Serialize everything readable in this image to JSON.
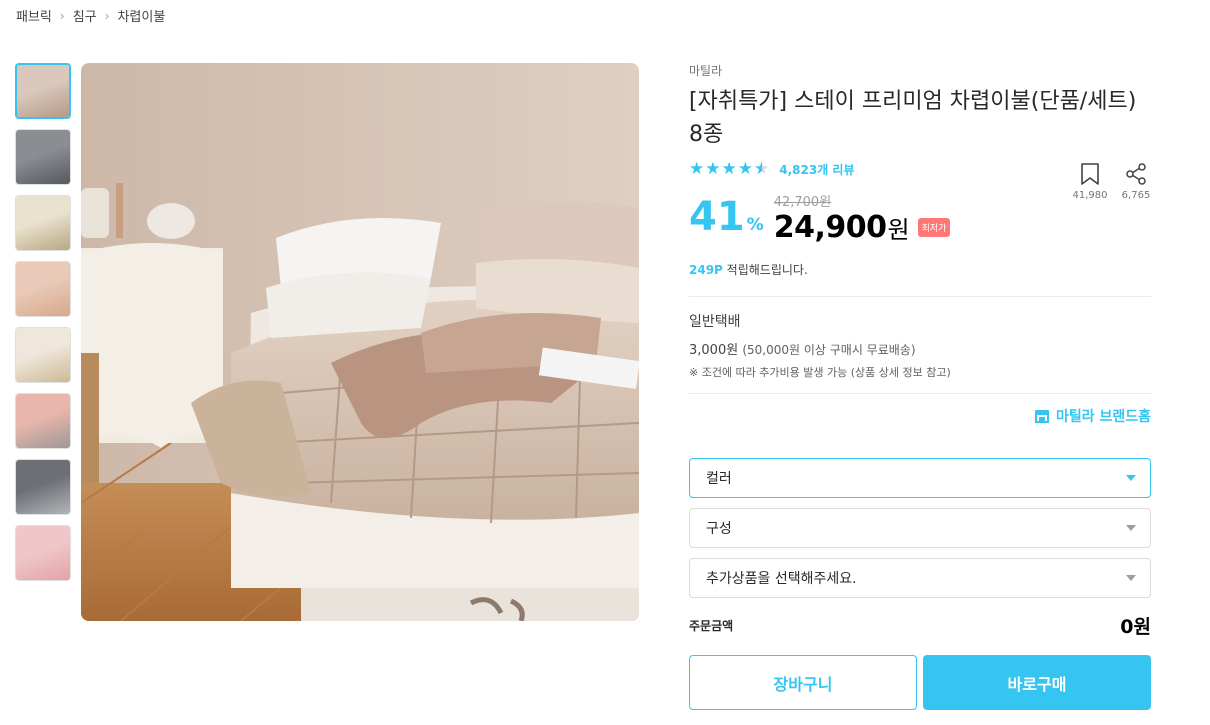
{
  "breadcrumb": [
    "패브릭",
    "침구",
    "차렵이불"
  ],
  "product": {
    "brand": "마틸라",
    "title": "[자취특가] 스테이 프리미엄 차렵이불(단품/세트) 8종",
    "review_count": "4,823개 리뷰",
    "rating": 4.5,
    "bookmark_count": "41,980",
    "share_count": "6,765",
    "discount": "41",
    "discount_unit": "%",
    "original_price": "42,700원",
    "sale_price": "24,900",
    "sale_unit": "원",
    "badge": "최저가",
    "points_value": "249P",
    "points_text": " 적립해드립니다."
  },
  "shipping": {
    "title": "일반택배",
    "fee": "3,000원",
    "fee_note": "(50,000원 이상 구매시 무료배송)",
    "note": "※ 조건에 따라 추가비용 발생 가능 (상품 상세 정보 참고)"
  },
  "brand_home": "마틸라 브랜드홈",
  "options": {
    "color": "컬러",
    "composition": "구성",
    "extra": "추가상품을 선택해주세요."
  },
  "order": {
    "label": "주문금액",
    "total": "0원"
  },
  "buttons": {
    "cart": "장바구니",
    "buy": "바로구매"
  },
  "colors": {
    "accent": "#35c5f0",
    "badge": "#ff7777"
  },
  "thumbnails": [
    {
      "name": "thumb-1",
      "colors": [
        "#d9c8bb",
        "#b59a86"
      ]
    },
    {
      "name": "thumb-2",
      "colors": [
        "#8a8d92",
        "#55585d"
      ]
    },
    {
      "name": "thumb-3",
      "colors": [
        "#e9e2cf",
        "#b8a782"
      ]
    },
    {
      "name": "thumb-4",
      "colors": [
        "#e9c9b8",
        "#d7a889"
      ]
    },
    {
      "name": "thumb-5",
      "colors": [
        "#efe7dc",
        "#cdb995"
      ]
    },
    {
      "name": "thumb-6",
      "colors": [
        "#e8b6ac",
        "#9d9895"
      ]
    },
    {
      "name": "thumb-7",
      "colors": [
        "#6c6f74",
        "#b2b5b8"
      ]
    },
    {
      "name": "thumb-8",
      "colors": [
        "#f0c7c8",
        "#e3a3a7"
      ]
    }
  ]
}
